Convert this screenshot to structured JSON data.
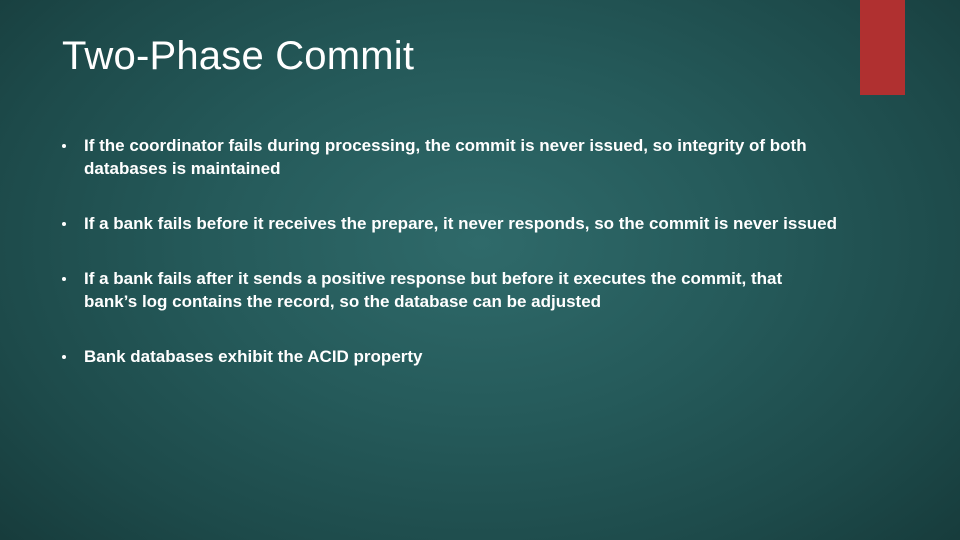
{
  "title": "Two-Phase Commit",
  "bullets": [
    "If the coordinator fails during processing, the commit is never issued, so integrity of both databases is maintained",
    "If a bank fails before it receives the prepare, it never responds, so the commit is never issued",
    "If a bank fails after it sends a positive response but before it executes the commit, that bank’s log contains the record, so the database can be adjusted",
    "Bank databases exhibit the ACID property"
  ]
}
